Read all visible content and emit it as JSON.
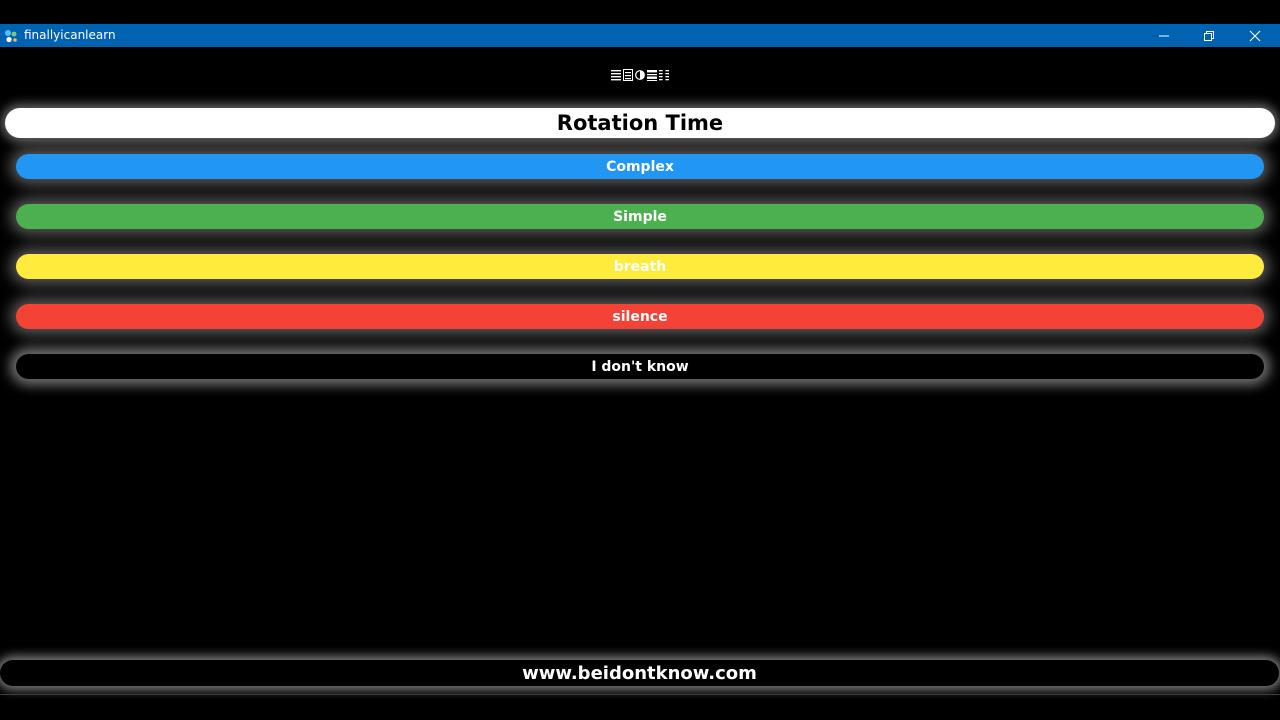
{
  "window": {
    "title": "finallyicanlearn",
    "titlebar_color": "#0063b1",
    "controls": [
      "minimize-icon",
      "restore-icon",
      "close-icon"
    ]
  },
  "toolbar": {
    "icons": [
      "list-icon",
      "grid-list-icon",
      "contrast-icon",
      "checklist-icon",
      "columns-icon"
    ]
  },
  "header": {
    "title": "Rotation Time"
  },
  "options": [
    {
      "label": "Complex",
      "color": "#2196f3"
    },
    {
      "label": "Simple",
      "color": "#4caf50"
    },
    {
      "label": "breath",
      "color": "#ffeb3b"
    },
    {
      "label": "silence",
      "color": "#f44336"
    },
    {
      "label": "I don't know",
      "color": "#000000"
    }
  ],
  "footer": {
    "text": "www.beidontknow.com"
  }
}
